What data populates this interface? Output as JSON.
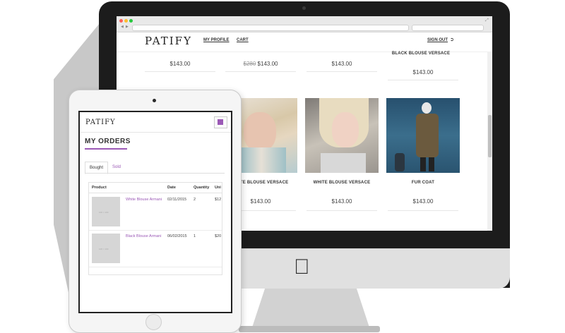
{
  "desktop": {
    "logo": "PATIFY",
    "nav": {
      "profile": "MY PROFILE",
      "cart": "CART",
      "signout": "SIGN OUT",
      "signout_icon": "sign-out-icon"
    },
    "row1": {
      "items": [
        {
          "price": "$143.00"
        },
        {
          "old_price": "$280",
          "price": "$143.00"
        },
        {
          "price": "$143.00"
        },
        {
          "name": "BLACK BLOUSE VERSACE",
          "price": "$143.00"
        }
      ]
    },
    "row2": {
      "items": [
        {
          "name": "WHITE BLOUSE VERSACE",
          "price": "$143.00",
          "image": "model-photo-blonde-scarf"
        },
        {
          "name": "WHITE BLOUSE VERSACE",
          "price": "$143.00",
          "image": "model-photo-blonde-hair"
        },
        {
          "name": "FUR COAT",
          "price": "$143.00",
          "image": "model-photo-fur-coat"
        }
      ]
    }
  },
  "tablet": {
    "logo": "PATIFY",
    "menu_icon": "hamburger-menu-icon",
    "title": "MY ORDERS",
    "tabs": [
      {
        "label": "Bought",
        "active": true
      },
      {
        "label": "Sold",
        "active": false
      }
    ],
    "table": {
      "headers": [
        "Product",
        "Date",
        "Quantity",
        "Uni"
      ],
      "rows": [
        {
          "thumb_label": "100 × 100",
          "product": "White Blouse Armani",
          "date": "02/11/2015",
          "quantity": "2",
          "unit": "$12"
        },
        {
          "thumb_label": "100 × 100",
          "product": "Black Blouse Armani",
          "date": "06/02/2015",
          "quantity": "1",
          "unit": "$20"
        }
      ]
    }
  },
  "colors": {
    "accent": "#9b59b6",
    "bezel": "#1c1c1c",
    "text": "#333333"
  }
}
